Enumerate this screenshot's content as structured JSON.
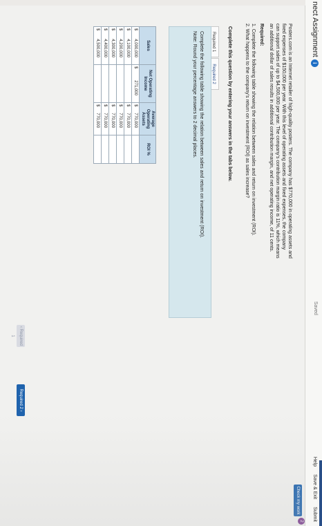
{
  "header": {
    "title": "nect Assignment",
    "info_glyph": "i",
    "saved_label": "Saved",
    "links": [
      "Help",
      "Save & Exit",
      "Submit"
    ],
    "check_button": "Check my work",
    "check_count": "2"
  },
  "problem": {
    "text": "Posters.com is an Internet retailer of high-quality posters. The company has $770,000 in operating assets and fixed expenses of $150,000 per year. With this level of operating assets and fixed expenses, the company can support sales of up to $4,500,000 per year. The company’s contribution margin ratio is 11%, which means an additional dollar of sales results in additional contribution margin, and net operating income, of 11 cents.",
    "required_heading": "Required:",
    "requirements": [
      "1. Complete the following table showing the relation between sales and return on investment (ROI).",
      "2. What happens to the company’s return on investment (ROI) as sales increase?"
    ]
  },
  "instructions": "Complete this question by entering your answers in the tabs below.",
  "tabs": [
    {
      "label": "Required 1"
    },
    {
      "label": "Required 2"
    }
  ],
  "panel": {
    "line1": "Complete the following table showing the relation between sales and return on investment (ROI).",
    "line2": "Note: Round your percentage answers to 2 decimal places."
  },
  "table": {
    "headers": [
      "Sales",
      "Net Operating Income",
      "Average Operating Assets",
      "ROI %"
    ],
    "rows": [
      {
        "sales_cur": "$",
        "sales": "4,000,000",
        "noi_cur": "$",
        "noi": "271,000",
        "assets_cur": "$",
        "assets": "770,000",
        "roi": ""
      },
      {
        "sales_cur": "$",
        "sales": "4,100,000",
        "noi_cur": "",
        "noi": "",
        "assets_cur": "$",
        "assets": "770,000",
        "roi": ""
      },
      {
        "sales_cur": "$",
        "sales": "4,200,000",
        "noi_cur": "",
        "noi": "",
        "assets_cur": "$",
        "assets": "770,000",
        "roi": ""
      },
      {
        "sales_cur": "$",
        "sales": "4,300,000",
        "noi_cur": "",
        "noi": "",
        "assets_cur": "$",
        "assets": "770,000",
        "roi": ""
      },
      {
        "sales_cur": "$",
        "sales": "4,400,000",
        "noi_cur": "",
        "noi": "",
        "assets_cur": "$",
        "assets": "770,000",
        "roi": ""
      },
      {
        "sales_cur": "$",
        "sales": "4,500,000",
        "noi_cur": "",
        "noi": "",
        "assets_cur": "$",
        "assets": "770,000",
        "roi": ""
      }
    ]
  },
  "nav": {
    "prev_label": "‹ Required 1",
    "next_label": "Required 2 ›"
  }
}
